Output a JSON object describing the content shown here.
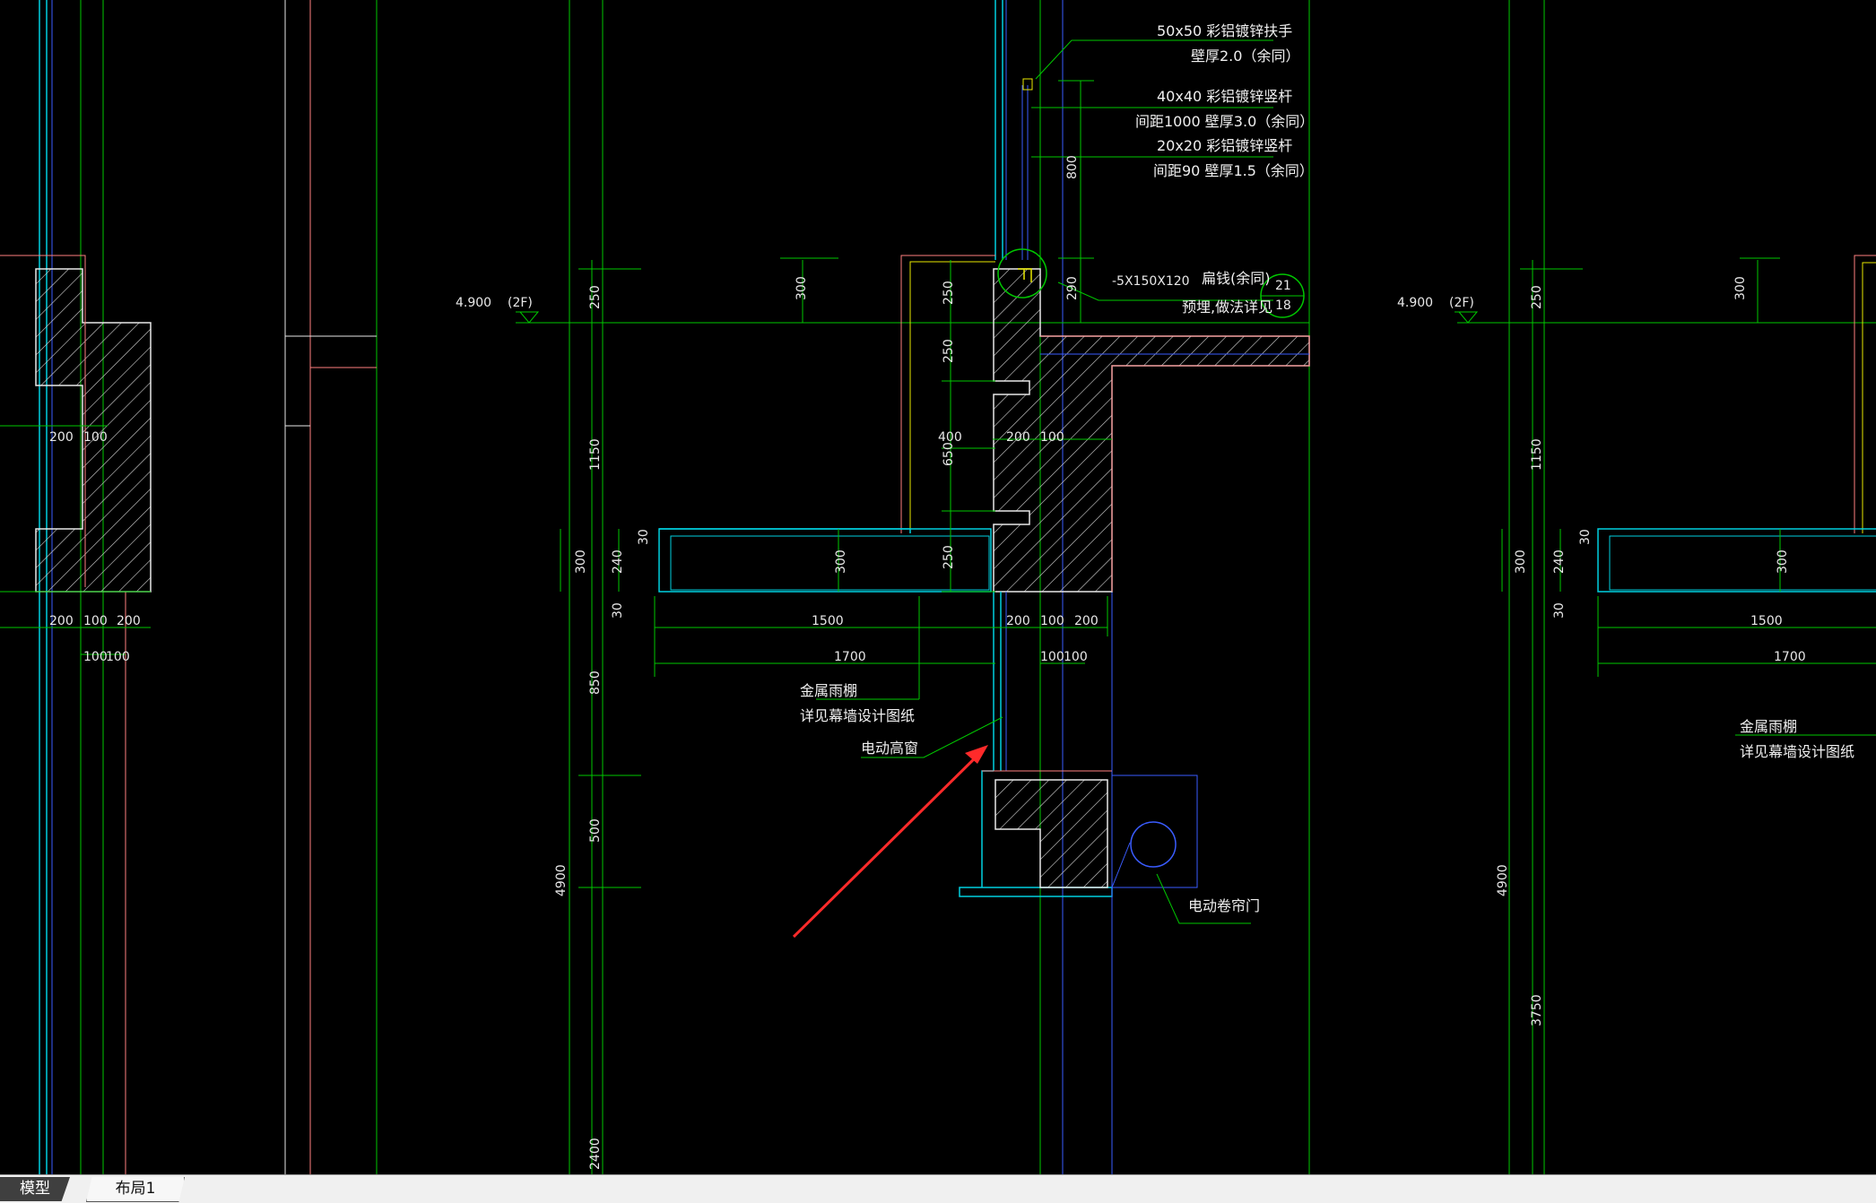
{
  "tabs": {
    "model": "模型",
    "layout1": "布局1"
  },
  "annotations": {
    "handrail_1": "50x50 彩铝镀锌扶手",
    "handrail_2": "壁厚2.0（余同）",
    "post_1": "40x40 彩铝镀锌竖杆",
    "post_2": "间距1000 壁厚3.0（余同）",
    "bar_1": "20x20 彩铝镀锌竖杆",
    "bar_2": "间距90 壁厚1.5（余同）",
    "plate": "-5X150X120",
    "flat_steel": "扁钱(余同)",
    "embed": "预埋,做法详见",
    "detail_top": "21",
    "detail_bottom": "18",
    "level_left": "4.900",
    "floor_left": "(2F)",
    "level_right": "4.900",
    "floor_right": "(2F)",
    "canopy_1": "金属雨棚",
    "canopy_2": "详见幕墙设计图纸",
    "canopy_r1": "金属雨棚",
    "canopy_r2": "详见幕墙设计图纸",
    "high_window": "电动高窗",
    "roller_door": "电动卷帘门"
  },
  "dims": {
    "d800": "800",
    "d290": "290",
    "d300a": "300",
    "d250a": "250",
    "d250b": "250",
    "d250c": "250",
    "d400": "400",
    "d650": "650",
    "d200a": "200",
    "d100a": "100",
    "d250d": "250",
    "d300b": "300",
    "d300c": "300",
    "d240": "240",
    "d30a": "30",
    "d30b": "30",
    "d1150": "1150",
    "d850": "850",
    "d500": "500",
    "d4900": "4900",
    "d2400": "2400",
    "d1500": "1500",
    "d1700": "1700",
    "d200b": "200",
    "d100b": "100",
    "d200c": "200",
    "d100c": "100",
    "d100d": "100",
    "l200a": "200",
    "l100a": "100",
    "l200b": "200",
    "l100b": "100",
    "l200c": "200",
    "l100c": "100",
    "l100d": "100",
    "r300a": "300",
    "r250": "250",
    "r1150": "1150",
    "r300b": "300",
    "r240": "240",
    "r30a": "30",
    "r30b": "30",
    "r300c": "300",
    "r1500": "1500",
    "r1700": "1700",
    "r4900": "4900",
    "r3750": "3750"
  },
  "colors": {
    "background": "#000000",
    "green": "#00c800",
    "cyan": "#00d0e0",
    "blue": "#3a5cff",
    "pink": "#ff8080",
    "white": "#e8e8e8",
    "arrow": "#ff2a2a",
    "yellow": "#e8e800"
  }
}
